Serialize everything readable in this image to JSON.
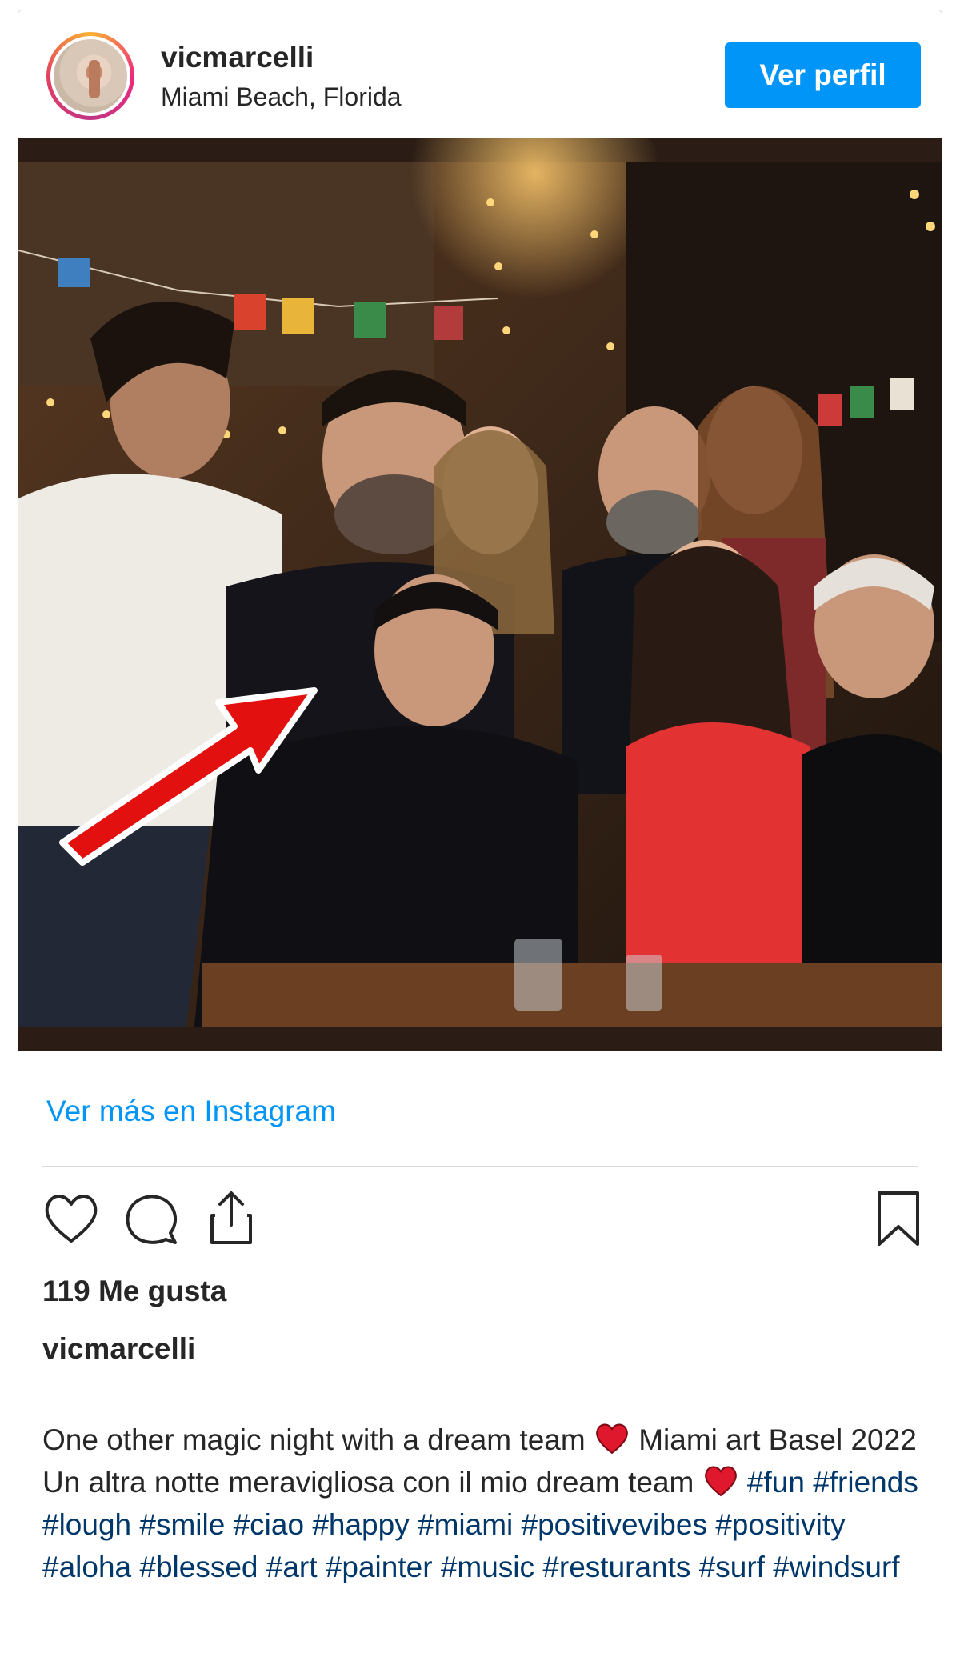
{
  "header": {
    "username": "vicmarcelli",
    "location": "Miami Beach, Florida",
    "profile_button": "Ver perfil"
  },
  "post": {
    "more_link": "Ver más en Instagram",
    "likes": "119 Me gusta",
    "caption_user": "vicmarcelli",
    "caption_line1_a": "One other magic night with a dream team",
    "caption_line1_b": "Miami art Basel 2022",
    "caption_line2_a": "Un altra notte meravigliosa con il mio dream team",
    "hashtags": [
      "#fun",
      "#friends",
      "#lough",
      "#smile",
      "#ciao",
      "#happy",
      "#miami",
      "#positivevibes",
      "#positivity",
      "#aloha",
      "#blessed",
      "#art",
      "#painter",
      "#music",
      "#resturants",
      "#surf",
      "#windsurf"
    ]
  },
  "icons": {
    "like": "heart-outline-icon",
    "comment": "comment-bubble-icon",
    "share": "share-upload-icon",
    "save": "bookmark-icon",
    "emoji": "red-heart-emoji-icon"
  },
  "colors": {
    "accent": "#0095f6",
    "hashtag": "#00376b",
    "text": "#262626",
    "heart_emoji": "#e0182d"
  }
}
